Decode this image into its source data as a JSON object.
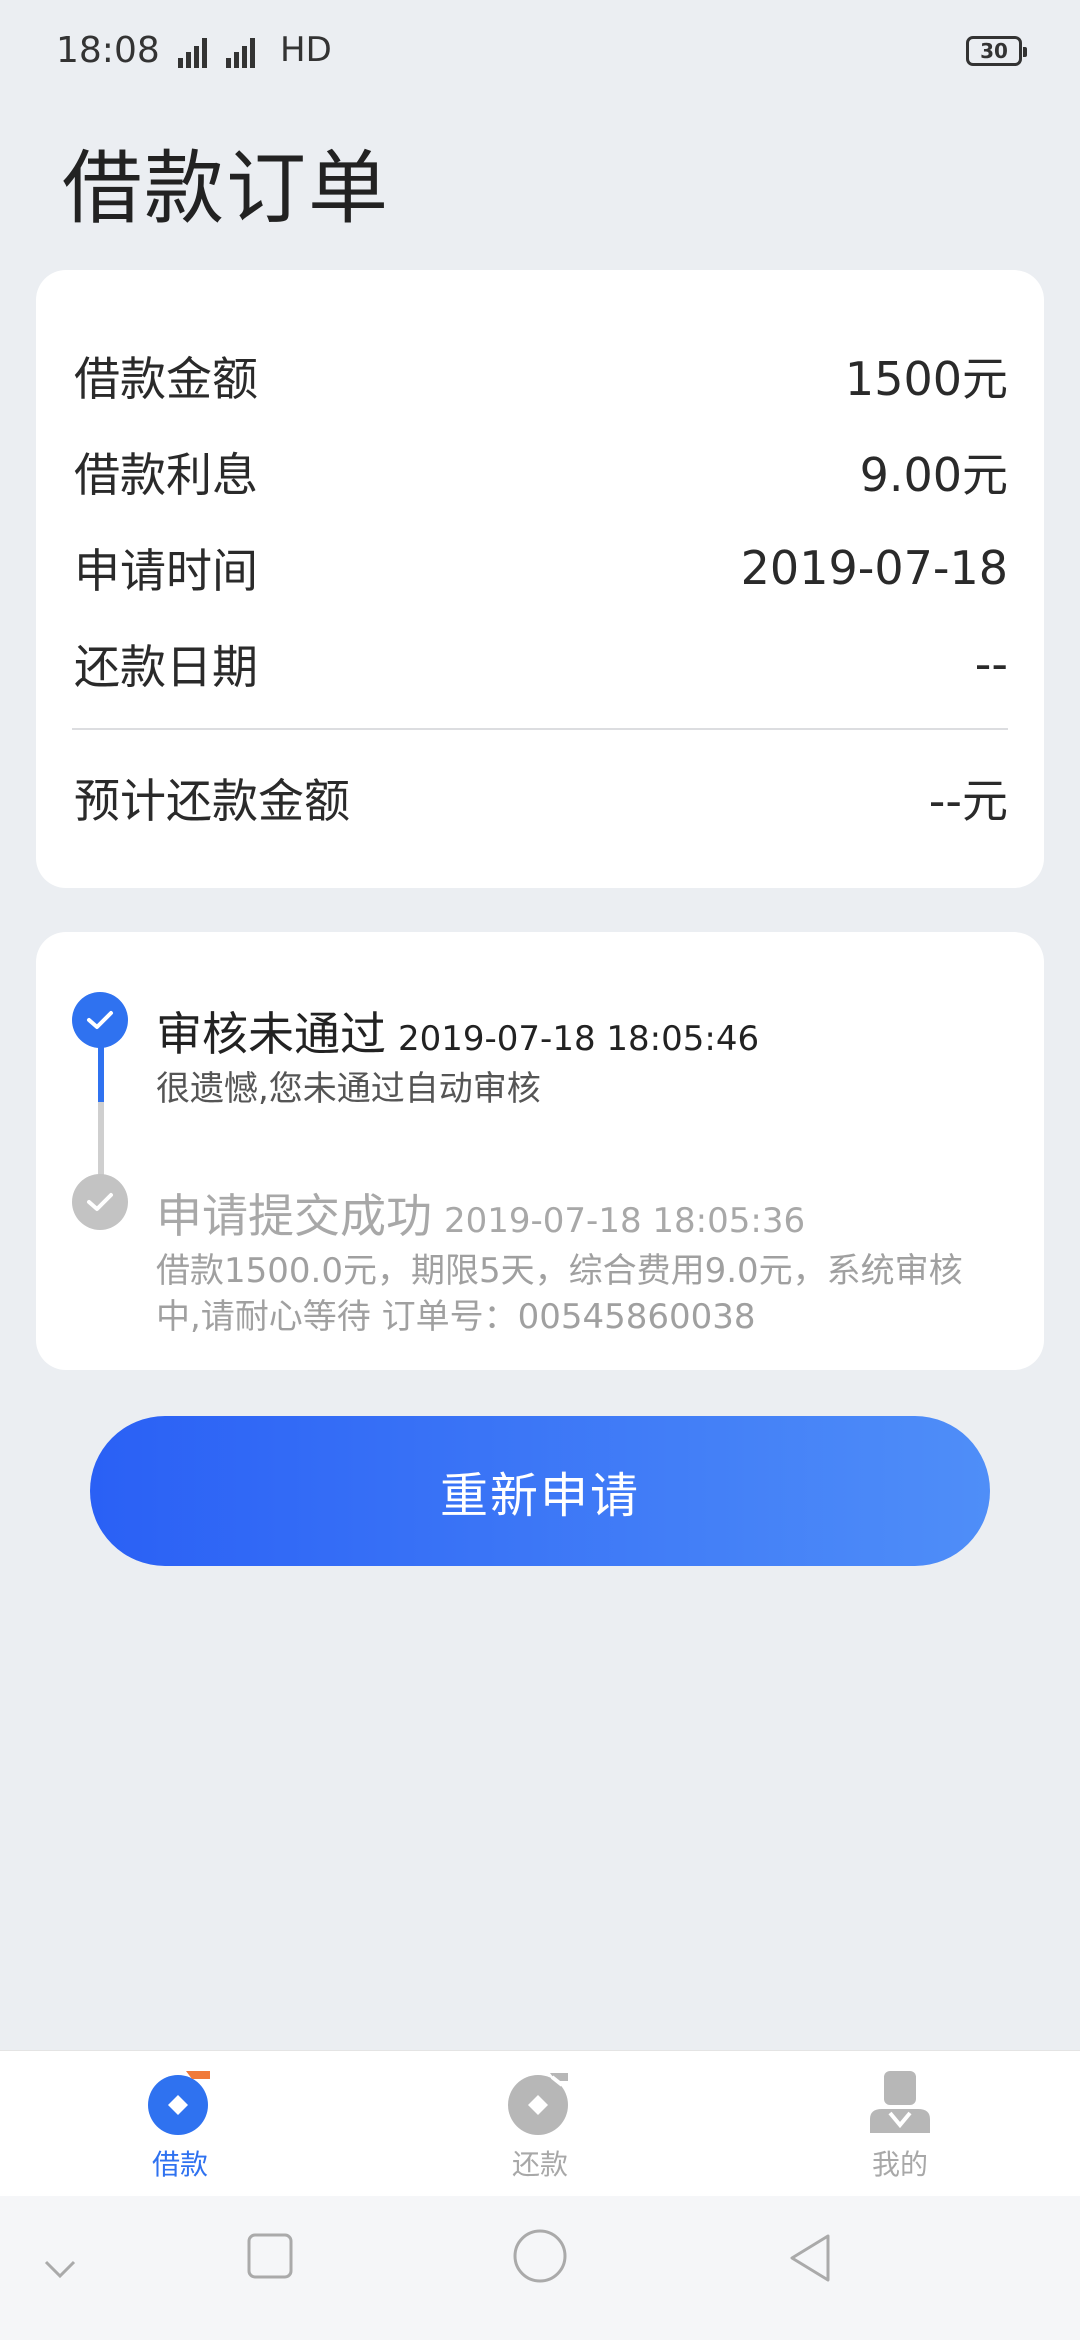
{
  "status_bar": {
    "time": "18:08",
    "network": "HD",
    "battery": "30"
  },
  "page": {
    "title": "借款订单"
  },
  "summary": {
    "rows": [
      {
        "label": "借款金额",
        "value": "1500元"
      },
      {
        "label": "借款利息",
        "value": "9.00元"
      },
      {
        "label": "申请时间",
        "value": "2019-07-18"
      },
      {
        "label": "还款日期",
        "value": "--"
      }
    ],
    "total": {
      "label": "预计还款金额",
      "value": "--元"
    }
  },
  "timeline": [
    {
      "title": "审核未通过",
      "time": "2019-07-18 18:05:46",
      "desc": "很遗憾,您未通过自动审核",
      "state": "active"
    },
    {
      "title": "申请提交成功",
      "time": "2019-07-18 18:05:36",
      "desc": "借款1500.0元，期限5天，综合费用9.0元，系统审核中,请耐心等待 订单号：00545860038",
      "state": "done"
    }
  ],
  "actions": {
    "reapply_label": "重新申请"
  },
  "tabs": [
    {
      "label": "借款",
      "icon": "loan-icon",
      "active": true
    },
    {
      "label": "还款",
      "icon": "repay-icon",
      "active": false
    },
    {
      "label": "我的",
      "icon": "profile-icon",
      "active": false
    }
  ],
  "colors": {
    "accent": "#2f72f0",
    "inactive": "#a8a8a8",
    "background": "#ebeef2"
  }
}
